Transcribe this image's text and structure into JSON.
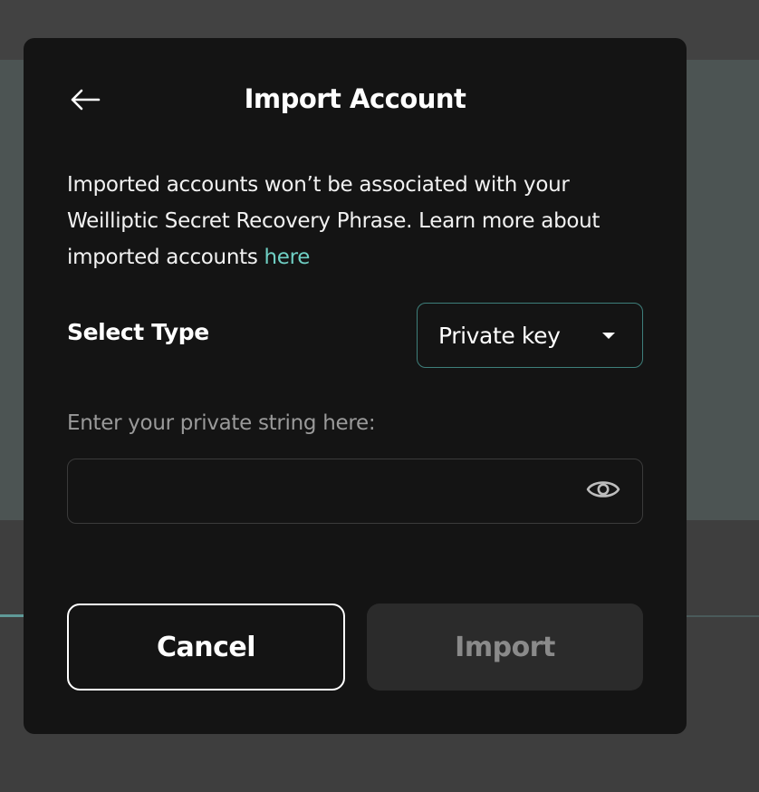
{
  "modal": {
    "title": "Import Account",
    "back_icon": "arrow-left-icon",
    "description_text": "Imported accounts won’t be associated with your Weilliptic Secret Recovery Phrase. Learn more about imported accounts ",
    "description_link": "here",
    "select_type": {
      "label": "Select Type",
      "value": "Private key",
      "icon": "caret-down-icon"
    },
    "private_key": {
      "label": "Enter your private string here:",
      "value": "",
      "placeholder": "",
      "toggle_icon": "eye-icon"
    },
    "buttons": {
      "cancel": "Cancel",
      "import": "Import"
    }
  },
  "colors": {
    "modal_bg": "#141414",
    "link": "#6fcfc4",
    "select_border": "#3e7f7b",
    "disabled_button_bg": "#2b2b2b",
    "disabled_button_text": "#8a8a8a"
  }
}
